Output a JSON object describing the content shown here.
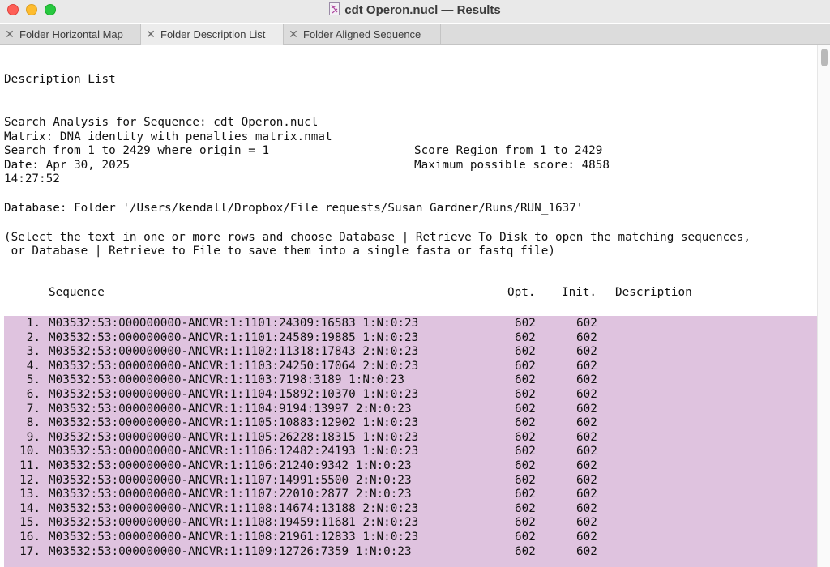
{
  "window": {
    "title": "cdt Operon.nucl — Results"
  },
  "tabs": [
    {
      "label": "Folder Horizontal Map"
    },
    {
      "label": "Folder Description List"
    },
    {
      "label": "Folder Aligned Sequence"
    }
  ],
  "report": {
    "heading": "Description List",
    "search_line": "Search Analysis for Sequence: cdt Operon.nucl",
    "matrix_line": "Matrix: DNA identity with penalties matrix.nmat",
    "range_line": "Search from 1 to 2429 where origin = 1",
    "score_region": "Score Region from 1 to 2429",
    "date_line": "Date: Apr 30, 2025",
    "max_score": "Maximum possible score: 4858",
    "time_line": "14:27:52",
    "database_line": "Database: Folder '/Users/kendall/Dropbox/File requests/Susan Gardner/Runs/RUN_1637'",
    "instructions_1": "(Select the text in one or more rows and choose Database | Retrieve To Disk to open the matching sequences,",
    "instructions_2": " or Database | Retrieve to File to save them into a single fasta or fastq file)"
  },
  "table": {
    "columns": {
      "sequence": "Sequence",
      "opt": "Opt.",
      "init": "Init.",
      "description": "Description"
    },
    "rows": [
      {
        "num": "1.",
        "seq": "M03532:53:000000000-ANCVR:1:1101:24309:16583 1:N:0:23",
        "opt": "602",
        "init": "602"
      },
      {
        "num": "2.",
        "seq": "M03532:53:000000000-ANCVR:1:1101:24589:19885 1:N:0:23",
        "opt": "602",
        "init": "602"
      },
      {
        "num": "3.",
        "seq": "M03532:53:000000000-ANCVR:1:1102:11318:17843 2:N:0:23",
        "opt": "602",
        "init": "602"
      },
      {
        "num": "4.",
        "seq": "M03532:53:000000000-ANCVR:1:1103:24250:17064 2:N:0:23",
        "opt": "602",
        "init": "602"
      },
      {
        "num": "5.",
        "seq": "M03532:53:000000000-ANCVR:1:1103:7198:3189 1:N:0:23",
        "opt": "602",
        "init": "602"
      },
      {
        "num": "6.",
        "seq": "M03532:53:000000000-ANCVR:1:1104:15892:10370 1:N:0:23",
        "opt": "602",
        "init": "602"
      },
      {
        "num": "7.",
        "seq": "M03532:53:000000000-ANCVR:1:1104:9194:13997 2:N:0:23",
        "opt": "602",
        "init": "602"
      },
      {
        "num": "8.",
        "seq": "M03532:53:000000000-ANCVR:1:1105:10883:12902 1:N:0:23",
        "opt": "602",
        "init": "602"
      },
      {
        "num": "9.",
        "seq": "M03532:53:000000000-ANCVR:1:1105:26228:18315 1:N:0:23",
        "opt": "602",
        "init": "602"
      },
      {
        "num": "10.",
        "seq": "M03532:53:000000000-ANCVR:1:1106:12482:24193 1:N:0:23",
        "opt": "602",
        "init": "602"
      },
      {
        "num": "11.",
        "seq": "M03532:53:000000000-ANCVR:1:1106:21240:9342 1:N:0:23",
        "opt": "602",
        "init": "602"
      },
      {
        "num": "12.",
        "seq": "M03532:53:000000000-ANCVR:1:1107:14991:5500 2:N:0:23",
        "opt": "602",
        "init": "602"
      },
      {
        "num": "13.",
        "seq": "M03532:53:000000000-ANCVR:1:1107:22010:2877 2:N:0:23",
        "opt": "602",
        "init": "602"
      },
      {
        "num": "14.",
        "seq": "M03532:53:000000000-ANCVR:1:1108:14674:13188 2:N:0:23",
        "opt": "602",
        "init": "602"
      },
      {
        "num": "15.",
        "seq": "M03532:53:000000000-ANCVR:1:1108:19459:11681 2:N:0:23",
        "opt": "602",
        "init": "602"
      },
      {
        "num": "16.",
        "seq": "M03532:53:000000000-ANCVR:1:1108:21961:12833 1:N:0:23",
        "opt": "602",
        "init": "602"
      },
      {
        "num": "17.",
        "seq": "M03532:53:000000000-ANCVR:1:1109:12726:7359 1:N:0:23",
        "opt": "602",
        "init": "602"
      }
    ]
  },
  "colors": {
    "selection": "#dfc3df",
    "close_red": "#fe5f57",
    "minimize_yellow": "#febc2e",
    "zoom_green": "#28c840"
  }
}
